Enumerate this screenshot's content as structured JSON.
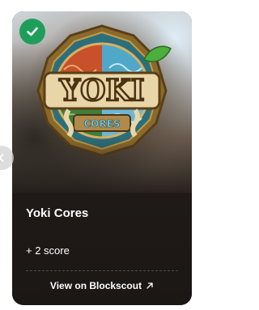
{
  "card": {
    "title": "Yoki Cores",
    "score": "+ 2 score",
    "link_label": "View on Blockscout",
    "logo_text": "YOKI",
    "logo_subtext": "CORES"
  },
  "icons": {
    "badge": "check-circle-icon",
    "nav": "chevron-left-icon",
    "link": "arrow-up-right-icon"
  },
  "colors": {
    "badge_green": "#1e9e5a",
    "card_bg": "#1f1a17",
    "text": "#ffffff"
  }
}
